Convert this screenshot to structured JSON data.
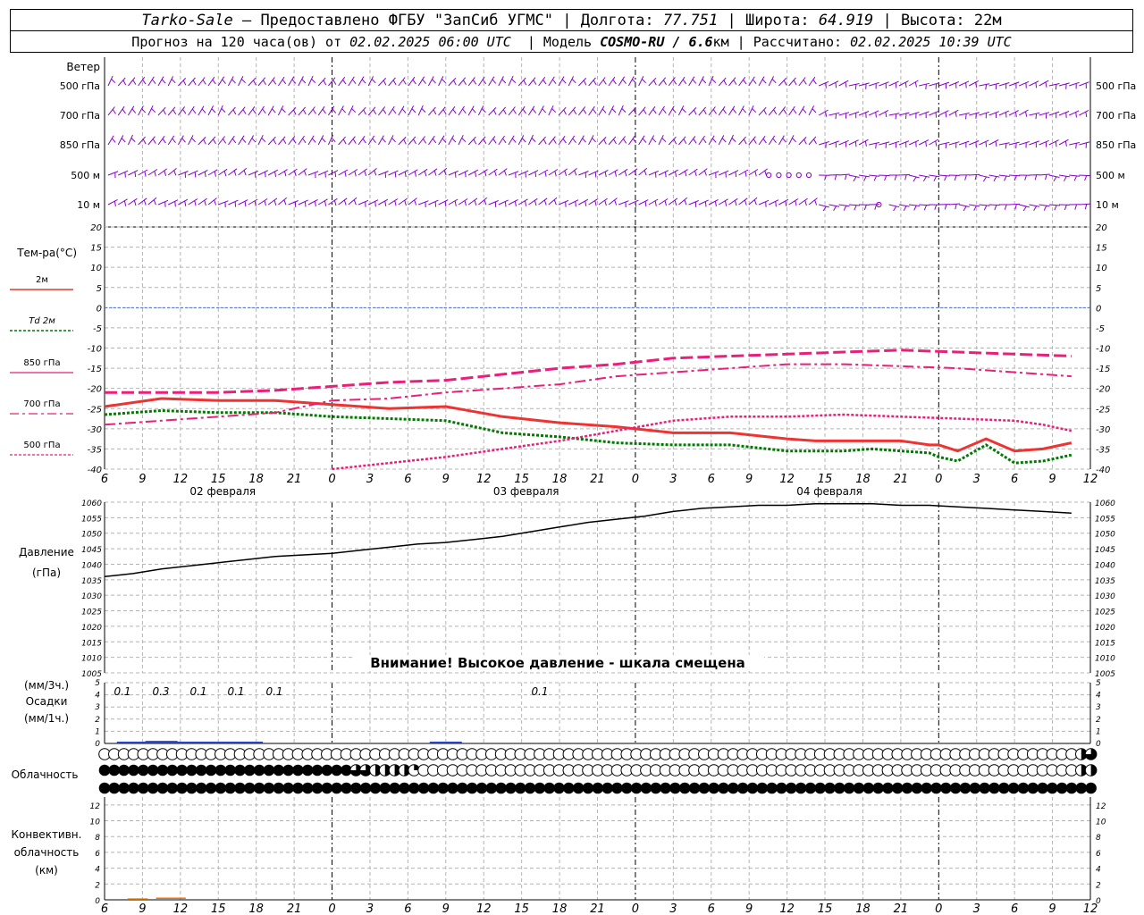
{
  "header": {
    "line1": {
      "station": "Tarko-Sale",
      "provider": "– Предоставлено ФГБУ \"ЗапСиб УГМС\"",
      "lon_label": "Долгота:",
      "lon_value": "77.751",
      "lat_label": "Широта:",
      "lat_value": "64.919",
      "alt_label": "Высота:",
      "alt_value": "22м"
    },
    "line2": {
      "forecast_prefix": "Прогноз на 120 часа(ов) от",
      "forecast_start": "02.02.2025 06:00 UTC",
      "model_label": "Модель",
      "model_name": "COSMO-RU / 6.6",
      "model_unit": "км",
      "calc_label": "Рассчитано:",
      "calc_time": "02.02.2025 10:39 UTC"
    }
  },
  "colors": {
    "wind": "#8800cc",
    "t2m": "#ee3333",
    "td2m": "#007a00",
    "upper": "#e8207a",
    "pressure": "#000000",
    "precip": "#2244cc",
    "conv": "#ee7700",
    "grid": "#b4b4b4",
    "zero_line": "#4a6ee0"
  },
  "x_axis": {
    "hour_ticks": [
      "6",
      "9",
      "12",
      "15",
      "18",
      "21",
      "0",
      "3",
      "6",
      "9",
      "12",
      "15",
      "18",
      "21",
      "0",
      "3",
      "6",
      "9",
      "12",
      "15",
      "18",
      "21",
      "0",
      "3",
      "6",
      "9",
      "12"
    ],
    "date_labels": [
      "02 февраля",
      "03 февраля",
      "04 февраля"
    ]
  },
  "wind_panel": {
    "title": "Ветер",
    "levels": [
      "500 гПа",
      "700 гПа",
      "850 гПа",
      "500 м",
      "10 м"
    ]
  },
  "temp_panel": {
    "title": "Тем-ра(°C)",
    "legend": [
      {
        "label": "2м"
      },
      {
        "label": "Td  2м"
      },
      {
        "label": "850 гПа"
      },
      {
        "label": "700 гПа"
      },
      {
        "label": "500 гПа"
      }
    ],
    "y_ticks": [
      "20",
      "15",
      "10",
      "5",
      "0",
      "-5",
      "-10",
      "-15",
      "-20",
      "-25",
      "-30",
      "-35",
      "-40"
    ]
  },
  "pressure_panel": {
    "title_line1": "Давление",
    "title_line2": "(гПа)",
    "y_ticks": [
      "1060",
      "1055",
      "1050",
      "1045",
      "1040",
      "1035",
      "1030",
      "1025",
      "1020",
      "1015",
      "1010",
      "1005"
    ],
    "warning": "Внимание! Высокое давление - шкала смещена"
  },
  "precip_panel": {
    "label_line1": "(мм/3ч.)",
    "label_line2": "Осадки",
    "label_line3": "(мм/1ч.)",
    "y_ticks": [
      "5",
      "4",
      "3",
      "2",
      "1",
      "0"
    ],
    "amounts": [
      {
        "hour": 9,
        "text": "0.1"
      },
      {
        "hour": 12,
        "text": "0.3"
      },
      {
        "hour": 15,
        "text": "0.1"
      },
      {
        "hour": 18,
        "text": "0.1"
      },
      {
        "hour": 21,
        "text": "0.1"
      },
      {
        "hour": 36,
        "text": "0.1"
      }
    ]
  },
  "cloud_panel": {
    "title": "Облачность"
  },
  "conv_panel": {
    "title_line1": "Конвективн.",
    "title_line2": "облачность",
    "title_line3": "(км)",
    "y_ticks": [
      "12",
      "10",
      "8",
      "6",
      "4",
      "2",
      "0"
    ]
  },
  "chart_data": [
    {
      "type": "line",
      "title": "Тем-ра(°C)",
      "x_unit": "hours from 02.02.2025 06:00 UTC",
      "ylim": [
        -40,
        20
      ],
      "grid": true,
      "series": [
        {
          "name": "2м",
          "x": [
            0,
            6,
            12,
            18,
            24,
            30,
            36,
            42,
            48,
            54,
            60,
            66,
            72,
            75,
            78,
            81,
            84,
            87,
            88,
            90,
            93,
            96,
            99,
            102
          ],
          "values": [
            -24.5,
            -22.5,
            -23,
            -23,
            -24,
            -25,
            -24.5,
            -27,
            -28.5,
            -29.5,
            -31,
            -31,
            -32.5,
            -33,
            -33,
            -33,
            -33,
            -34,
            -34,
            -35.5,
            -32.5,
            -35.5,
            -35,
            -33.5
          ]
        },
        {
          "name": "Td  2м",
          "x": [
            0,
            6,
            12,
            18,
            24,
            30,
            36,
            42,
            48,
            54,
            60,
            66,
            72,
            75,
            78,
            81,
            84,
            87,
            88,
            90,
            93,
            96,
            99,
            102
          ],
          "values": [
            -26.5,
            -25.5,
            -26,
            -26,
            -27,
            -27.5,
            -28,
            -31,
            -32,
            -33.5,
            -34,
            -34,
            -35.5,
            -35.5,
            -35.5,
            -35,
            -35.5,
            -36,
            -37,
            -38,
            -34,
            -38.5,
            -38,
            -36.5
          ]
        },
        {
          "name": "850 гПа",
          "x": [
            0,
            6,
            12,
            18,
            24,
            30,
            36,
            42,
            48,
            54,
            60,
            66,
            72,
            78,
            84,
            90,
            96,
            102
          ],
          "values": [
            -29,
            -28,
            -27,
            -26,
            -23,
            -22.5,
            -21,
            -20,
            -19,
            -17,
            -16,
            -15,
            -14,
            -14,
            -14.5,
            -15,
            -16,
            -17
          ]
        },
        {
          "name": "700 гПа",
          "x": [
            0,
            6,
            12,
            18,
            24,
            30,
            36,
            42,
            48,
            54,
            60,
            66,
            72,
            78,
            84,
            90,
            96,
            102
          ],
          "values": [
            -21,
            -21,
            -21,
            -20.5,
            -19.5,
            -18.5,
            -18,
            -16.5,
            -15,
            -14,
            -12.5,
            -12,
            -11.5,
            -11,
            -10.5,
            -11,
            -11.5,
            -12
          ]
        },
        {
          "name": "500 гПа",
          "x": [
            24,
            30,
            36,
            42,
            48,
            54,
            60,
            66,
            72,
            78,
            84,
            90,
            96,
            99,
            102
          ],
          "values": [
            -40,
            -38.5,
            -37,
            -35,
            -33,
            -30.5,
            -28,
            -27,
            -27,
            -26.5,
            -27,
            -27.5,
            -28,
            -29,
            -30.5
          ]
        }
      ]
    },
    {
      "type": "line",
      "title": "Давление (гПа)",
      "x_unit": "hours from 02.02.2025 06:00 UTC",
      "ylim": [
        1005,
        1060
      ],
      "grid": true,
      "series": [
        {
          "name": "Давление",
          "x": [
            0,
            3,
            6,
            9,
            12,
            15,
            18,
            21,
            24,
            27,
            30,
            33,
            36,
            39,
            42,
            45,
            48,
            51,
            54,
            57,
            60,
            63,
            66,
            69,
            72,
            75,
            78,
            81,
            84,
            87,
            90,
            93,
            96,
            99,
            102
          ],
          "values": [
            1036,
            1037,
            1038.5,
            1039.5,
            1040.5,
            1041.5,
            1042.5,
            1043,
            1043.5,
            1044.5,
            1045.5,
            1046.5,
            1047,
            1048,
            1049,
            1050.5,
            1052,
            1053.5,
            1054.5,
            1055.5,
            1057,
            1058,
            1058.5,
            1059,
            1059,
            1059.5,
            1059.5,
            1059.5,
            1059,
            1059,
            1058.5,
            1058,
            1057.5,
            1057,
            1056.5
          ]
        }
      ]
    },
    {
      "type": "bar",
      "title": "Осадки (мм/3ч.)",
      "x_unit": "hours from 02.02.2025 06:00 UTC",
      "ylim": [
        0,
        5
      ],
      "categories": [
        "9",
        "12",
        "15",
        "18",
        "21",
        "18"
      ],
      "x": [
        3,
        6,
        9,
        12,
        15,
        36
      ],
      "values": [
        0.1,
        0.3,
        0.1,
        0.1,
        0.1,
        0.1
      ]
    },
    {
      "type": "table",
      "title": "Облачность",
      "note": "cover per hour column; rows from top: upper, middle, low; 0=clear circle, 1=full black circle, 0.5=half",
      "rows": [
        {
          "level": "upper",
          "cover": [
            0,
            0,
            0,
            0,
            0,
            0,
            0,
            0,
            0,
            0,
            0,
            0,
            0,
            0,
            0,
            0,
            0,
            0,
            0,
            0,
            0,
            0,
            0,
            0,
            0,
            0,
            0,
            0,
            0,
            0,
            0,
            0,
            0,
            0,
            0,
            0,
            0,
            0,
            0,
            0,
            0,
            0,
            0,
            0,
            0,
            0,
            0,
            0,
            0,
            0,
            0,
            0,
            0,
            0,
            0,
            0,
            0,
            0,
            0,
            0,
            0,
            0,
            0,
            0,
            0,
            0,
            0,
            0,
            0,
            0,
            0,
            0,
            0,
            0,
            0,
            0,
            0,
            0,
            0,
            0,
            0,
            0,
            0,
            0,
            0,
            0,
            0,
            0,
            0,
            0,
            0,
            0,
            0,
            0,
            0,
            0,
            0,
            0,
            0,
            0,
            0,
            0.5,
            0.75
          ]
        },
        {
          "level": "middle",
          "cover": [
            1,
            1,
            1,
            1,
            1,
            1,
            1,
            1,
            1,
            1,
            1,
            1,
            1,
            1,
            1,
            1,
            1,
            1,
            1,
            1,
            1,
            1,
            1,
            1,
            1,
            1,
            0.75,
            0.75,
            0.5,
            0.5,
            0.5,
            0.5,
            0.25,
            0,
            0,
            0,
            0,
            0,
            0,
            0,
            0,
            0,
            0,
            0,
            0,
            0,
            0,
            0,
            0,
            0,
            0,
            0,
            0,
            0,
            0,
            0,
            0,
            0,
            0,
            0,
            0,
            0,
            0,
            0,
            0,
            0,
            0,
            0,
            0,
            0,
            0,
            0,
            0,
            0,
            0,
            0,
            0,
            0,
            0,
            0,
            0,
            0,
            0,
            0,
            0,
            0,
            0,
            0,
            0,
            0,
            0,
            0,
            0,
            0,
            0,
            0,
            0,
            0,
            0,
            0,
            0,
            0.5,
            0.5
          ]
        },
        {
          "level": "low",
          "cover": [
            1,
            1,
            1,
            1,
            1,
            1,
            1,
            1,
            1,
            1,
            1,
            1,
            1,
            1,
            1,
            1,
            1,
            1,
            1,
            1,
            1,
            1,
            1,
            1,
            1,
            1,
            1,
            1,
            1,
            1,
            1,
            1,
            1,
            1,
            1,
            1,
            1,
            1,
            1,
            1,
            1,
            1,
            1,
            1,
            1,
            1,
            1,
            1,
            1,
            1,
            1,
            1,
            1,
            1,
            1,
            1,
            1,
            1,
            1,
            1,
            1,
            1,
            1,
            1,
            1,
            1,
            1,
            1,
            1,
            1,
            1,
            1,
            1,
            1,
            1,
            1,
            1,
            1,
            1,
            1,
            1,
            1,
            1,
            1,
            1,
            1,
            1,
            1,
            1,
            1,
            1,
            1,
            1,
            1,
            1,
            1,
            1,
            1,
            1,
            1,
            1,
            1,
            1
          ]
        }
      ]
    },
    {
      "type": "bar",
      "title": "Конвективн. облачность (км)",
      "x_unit": "hours from 02.02.2025 06:00 UTC",
      "ylim": [
        0,
        13
      ],
      "x": [
        3,
        4,
        6,
        7,
        8
      ],
      "values": [
        0.1,
        0.1,
        0.2,
        0.2,
        0.2
      ]
    }
  ]
}
